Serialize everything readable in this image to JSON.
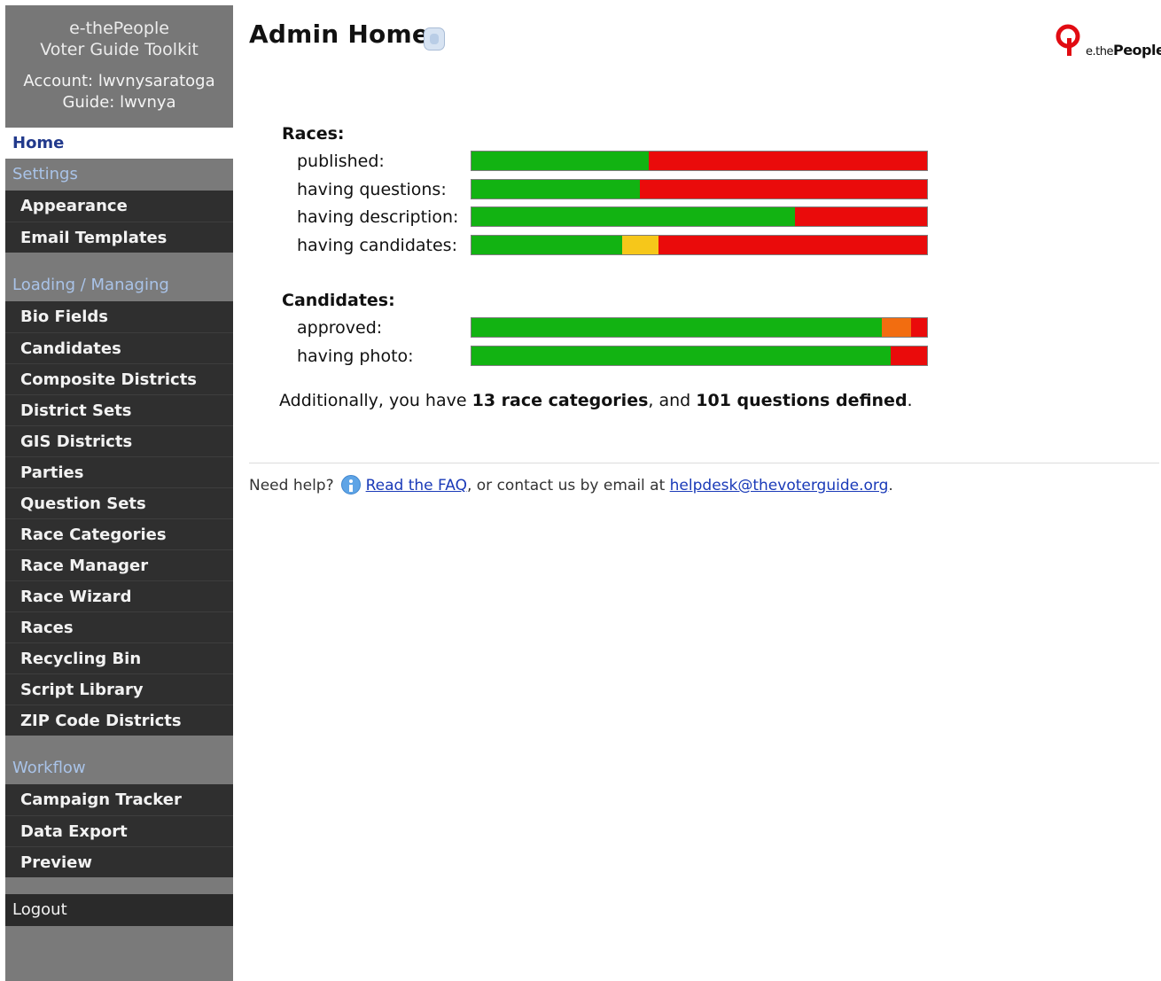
{
  "brand": {
    "line1": "e-thePeople",
    "line2": "Voter Guide Toolkit",
    "account": "Account: lwvnysaratoga",
    "guide": "Guide: lwvnya"
  },
  "nav": {
    "home": "Home",
    "sections": [
      {
        "title": "Settings",
        "items": [
          "Appearance",
          "Email Templates"
        ]
      },
      {
        "title": "Loading / Managing",
        "items": [
          "Bio Fields",
          "Candidates",
          "Composite Districts",
          "District Sets",
          "GIS Districts",
          "Parties",
          "Question Sets",
          "Race Categories",
          "Race Manager",
          "Race Wizard",
          "Races",
          "Recycling Bin",
          "Script Library",
          "ZIP Code Districts"
        ]
      },
      {
        "title": "Workflow",
        "items": [
          "Campaign Tracker",
          "Data Export",
          "Preview"
        ]
      }
    ],
    "logout": "Logout"
  },
  "page": {
    "title": "Admin Home",
    "info_icon": "info-icon"
  },
  "logo": {
    "prefix": "e.the",
    "name": "People"
  },
  "stats": {
    "races": {
      "label": "Races:",
      "rows": [
        {
          "label": "published:",
          "green": 0.39,
          "yellow": 0,
          "orange": 0,
          "red": 0.61
        },
        {
          "label": "having questions:",
          "green": 0.37,
          "yellow": 0,
          "orange": 0,
          "red": 0.63
        },
        {
          "label": "having description:",
          "green": 0.71,
          "yellow": 0,
          "orange": 0,
          "red": 0.29
        },
        {
          "label": "having candidates:",
          "green": 0.33,
          "yellow": 0.08,
          "orange": 0,
          "red": 0.59
        }
      ]
    },
    "candidates": {
      "label": "Candidates:",
      "rows": [
        {
          "label": "approved:",
          "green": 0.9,
          "yellow": 0,
          "orange": 0.065,
          "red": 0.035
        },
        {
          "label": "having photo:",
          "green": 0.92,
          "yellow": 0,
          "orange": 0,
          "red": 0.08
        }
      ]
    },
    "colors": {
      "green": "#12b312",
      "yellow": "#f6c71a",
      "orange": "#f26d10",
      "red": "#ea0b0b"
    }
  },
  "summary": {
    "prefix": "Additionally, you have ",
    "categories": "13 race categories",
    "middle": ", and ",
    "questions": "101 questions defined",
    "suffix": "."
  },
  "help": {
    "prefix": "Need help?",
    "faq_link": "Read the FAQ",
    "middle": ", or contact us by email at ",
    "email": "helpdesk@thevoterguide.org",
    "suffix": "."
  }
}
